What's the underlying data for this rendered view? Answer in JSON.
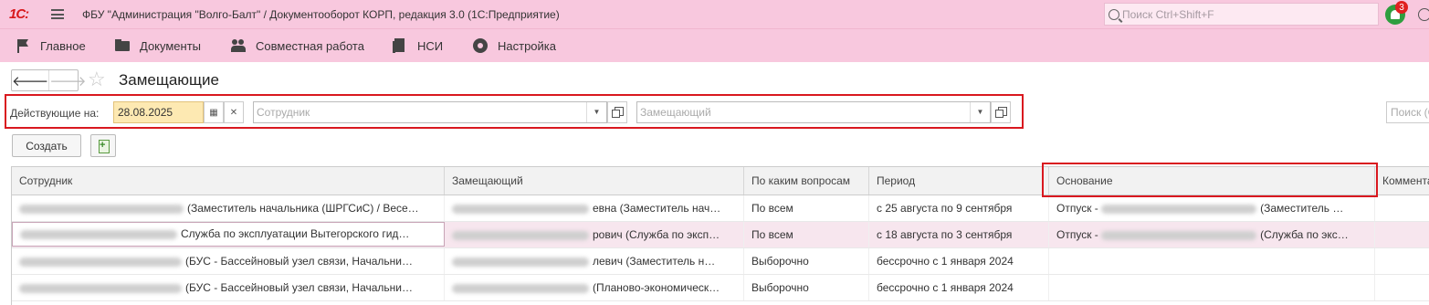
{
  "app": {
    "logo": "1С:",
    "title": "ФБУ \"Администрация \"Волго-Балт\" / Документооборот КОРП, редакция 3.0  (1С:Предприятие)",
    "search_placeholder": "Поиск Ctrl+Shift+F",
    "notifications_count": "3"
  },
  "menu": [
    {
      "label": "Главное",
      "icon": "flag-icon"
    },
    {
      "label": "Документы",
      "icon": "folder-icon"
    },
    {
      "label": "Совместная работа",
      "icon": "people-icon"
    },
    {
      "label": "НСИ",
      "icon": "book-icon"
    },
    {
      "label": "Настройка",
      "icon": "gear-icon"
    }
  ],
  "page": {
    "title": "Замещающие",
    "back": "🡐",
    "forward": "🡒"
  },
  "filters": {
    "active_label": "Действующие на:",
    "date_value": "28.08.2025",
    "employee_placeholder": "Сотрудник",
    "substitute_placeholder": "Замещающий",
    "search_placeholder": "Поиск (Ctrl+F)"
  },
  "commands": {
    "create_label": "Создать"
  },
  "table": {
    "columns": [
      "Сотрудник",
      "Замещающий",
      "По каким вопросам",
      "Период",
      "Основание",
      "Комментарий"
    ],
    "rows": [
      {
        "employee": "(Заместитель начальника (ШРГСиС) / Весе…",
        "substitute": "евна (Заместитель нач…",
        "questions": "По всем",
        "period": "с 25 августа по 9 сентября",
        "basis_prefix": "Отпуск -",
        "basis": "(Заместитель …"
      },
      {
        "employee": "Служба по эксплуатации Вытегорского гид…",
        "substitute": "рович (Служба по эксп…",
        "questions": "По всем",
        "period": "с 18 августа по 3 сентября",
        "basis_prefix": "Отпуск -",
        "basis": "(Служба по экс…"
      },
      {
        "employee": "(БУС - Бассейновый узел связи, Начальни…",
        "substitute": "левич (Заместитель н…",
        "questions": "Выборочно",
        "period": "бессрочно с 1 января 2024",
        "basis_prefix": "",
        "basis": ""
      },
      {
        "employee": "(БУС - Бассейновый узел связи, Начальни…",
        "substitute": "(Планово-экономическ…",
        "questions": "Выборочно",
        "period": "бессрочно с 1 января 2024",
        "basis_prefix": "",
        "basis": ""
      }
    ]
  }
}
